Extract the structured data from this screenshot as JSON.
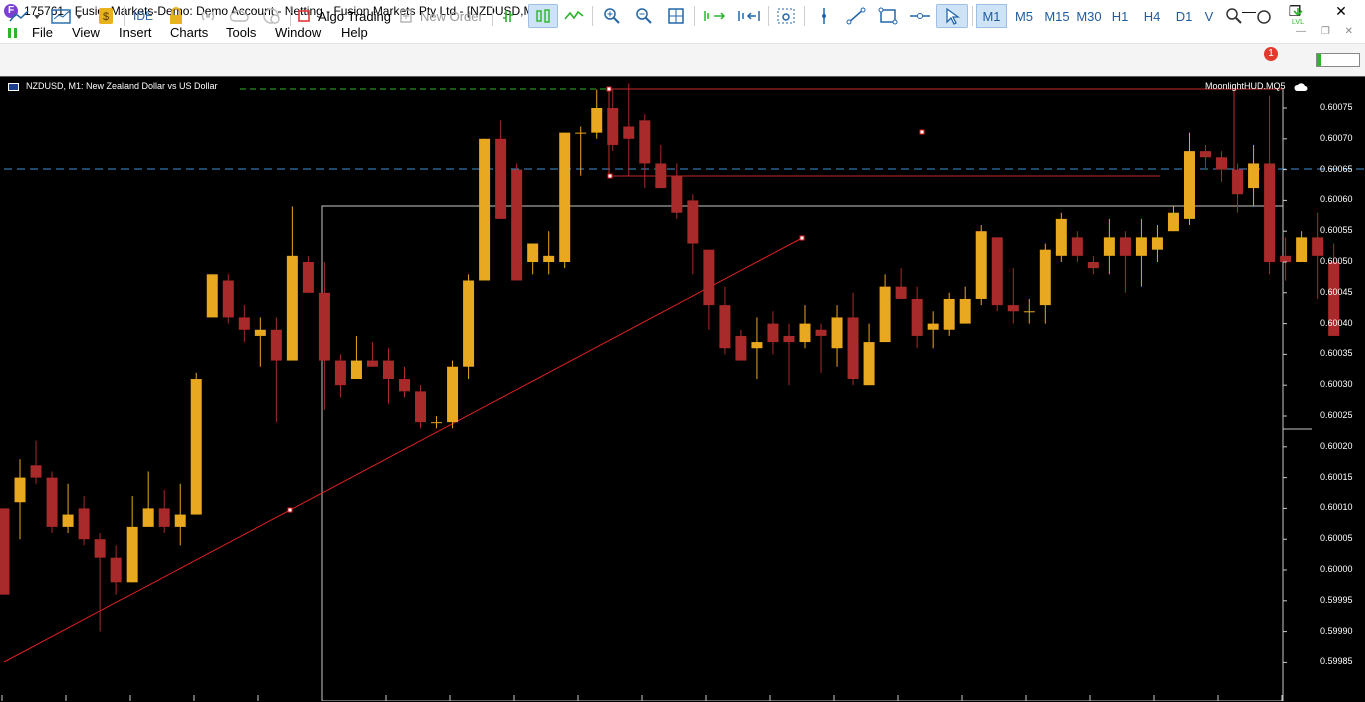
{
  "titlebar": {
    "app_icon": "F",
    "title": "175761 - FusionMarkets-Demo: Demo Account - Netting - Fusion Markets Pty Ltd - [NZDUSD,M1]",
    "minimize": "—",
    "maximize": "❐",
    "close": "✕"
  },
  "menu": {
    "items": [
      "File",
      "View",
      "Insert",
      "Charts",
      "Tools",
      "Window",
      "Help"
    ],
    "right_controls": "— ❐ ✕"
  },
  "toolbar": {
    "ide_label": "IDE",
    "algo_trading_label": "Algo Trading",
    "new_order_label": "New Order",
    "timeframes": [
      "M1",
      "M5",
      "M15",
      "M30",
      "H1",
      "H4",
      "D1",
      "V"
    ],
    "active_timeframe": "M1",
    "notification_count": "1",
    "signal_level": 0.1,
    "accent_color": "#2266aa"
  },
  "chart": {
    "title": "NZDUSD, M1:  New Zealand Dollar vs US Dollar",
    "indicator_name": "MoonlightHUD.MQ5",
    "price_labels": [
      "0.60075",
      "0.60070",
      "0.60065",
      "0.60060",
      "0.60055",
      "0.60050",
      "0.60045",
      "0.60040",
      "0.60035",
      "0.60030",
      "0.60025",
      "0.60020",
      "0.60015",
      "0.60010",
      "0.60005",
      "0.60000",
      "0.59995",
      "0.59990",
      "0.59985"
    ],
    "bull_color": "#e8a820",
    "bear_color": "#a82a2a",
    "background_color": "#000000"
  },
  "chart_data": {
    "type": "candlestick",
    "symbol": "NZDUSD",
    "timeframe": "M1",
    "ylim": [
      0.59982,
      0.60079
    ],
    "grid": false,
    "candles": [
      {
        "o": 0.6001,
        "h": 0.6001,
        "l": 0.59996,
        "c": 0.59996
      },
      {
        "o": 0.60011,
        "h": 0.60018,
        "l": 0.60005,
        "c": 0.60015
      },
      {
        "o": 0.60017,
        "h": 0.60021,
        "l": 0.60014,
        "c": 0.60015
      },
      {
        "o": 0.60015,
        "h": 0.60016,
        "l": 0.60006,
        "c": 0.60007
      },
      {
        "o": 0.60007,
        "h": 0.60014,
        "l": 0.60006,
        "c": 0.60009
      },
      {
        "o": 0.6001,
        "h": 0.60012,
        "l": 0.60004,
        "c": 0.60005
      },
      {
        "o": 0.60005,
        "h": 0.60006,
        "l": 0.5999,
        "c": 0.60002
      },
      {
        "o": 0.60002,
        "h": 0.60004,
        "l": 0.59996,
        "c": 0.59998
      },
      {
        "o": 0.59998,
        "h": 0.60012,
        "l": 0.59998,
        "c": 0.60007
      },
      {
        "o": 0.60007,
        "h": 0.60016,
        "l": 0.60007,
        "c": 0.6001
      },
      {
        "o": 0.6001,
        "h": 0.60013,
        "l": 0.60006,
        "c": 0.60007
      },
      {
        "o": 0.60007,
        "h": 0.60014,
        "l": 0.60004,
        "c": 0.60009
      },
      {
        "o": 0.60009,
        "h": 0.60032,
        "l": 0.60009,
        "c": 0.60031
      },
      {
        "o": 0.60041,
        "h": 0.60048,
        "l": 0.60041,
        "c": 0.60048
      },
      {
        "o": 0.60047,
        "h": 0.60048,
        "l": 0.6004,
        "c": 0.60041
      },
      {
        "o": 0.60041,
        "h": 0.60043,
        "l": 0.60037,
        "c": 0.60039
      },
      {
        "o": 0.60038,
        "h": 0.60041,
        "l": 0.60033,
        "c": 0.60039
      },
      {
        "o": 0.60039,
        "h": 0.60041,
        "l": 0.60024,
        "c": 0.60034
      },
      {
        "o": 0.60034,
        "h": 0.60059,
        "l": 0.60034,
        "c": 0.60051
      },
      {
        "o": 0.6005,
        "h": 0.60051,
        "l": 0.60045,
        "c": 0.60045
      },
      {
        "o": 0.60045,
        "h": 0.6005,
        "l": 0.60026,
        "c": 0.60034
      },
      {
        "o": 0.60034,
        "h": 0.60035,
        "l": 0.60028,
        "c": 0.6003
      },
      {
        "o": 0.60031,
        "h": 0.60038,
        "l": 0.60031,
        "c": 0.60034
      },
      {
        "o": 0.60034,
        "h": 0.60037,
        "l": 0.60033,
        "c": 0.60033
      },
      {
        "o": 0.60034,
        "h": 0.60036,
        "l": 0.60027,
        "c": 0.60031
      },
      {
        "o": 0.60031,
        "h": 0.60033,
        "l": 0.60028,
        "c": 0.60029
      },
      {
        "o": 0.60029,
        "h": 0.6003,
        "l": 0.60023,
        "c": 0.60024
      },
      {
        "o": 0.60024,
        "h": 0.60025,
        "l": 0.60023,
        "c": 0.60024
      },
      {
        "o": 0.60024,
        "h": 0.60034,
        "l": 0.60023,
        "c": 0.60033
      },
      {
        "o": 0.60033,
        "h": 0.60048,
        "l": 0.60031,
        "c": 0.60047
      },
      {
        "o": 0.60047,
        "h": 0.6007,
        "l": 0.60047,
        "c": 0.6007
      },
      {
        "o": 0.6007,
        "h": 0.60073,
        "l": 0.60057,
        "c": 0.60057
      },
      {
        "o": 0.60065,
        "h": 0.60066,
        "l": 0.60047,
        "c": 0.60047
      },
      {
        "o": 0.6005,
        "h": 0.60052,
        "l": 0.60048,
        "c": 0.60053
      },
      {
        "o": 0.6005,
        "h": 0.60055,
        "l": 0.60048,
        "c": 0.60051
      },
      {
        "o": 0.6005,
        "h": 0.60071,
        "l": 0.60049,
        "c": 0.60071
      },
      {
        "o": 0.60071,
        "h": 0.60072,
        "l": 0.60064,
        "c": 0.60071
      },
      {
        "o": 0.60071,
        "h": 0.60078,
        "l": 0.6007,
        "c": 0.60075
      },
      {
        "o": 0.60075,
        "h": 0.60078,
        "l": 0.60068,
        "c": 0.60069
      },
      {
        "o": 0.60072,
        "h": 0.60079,
        "l": 0.60064,
        "c": 0.6007
      },
      {
        "o": 0.60073,
        "h": 0.60074,
        "l": 0.60062,
        "c": 0.60066
      },
      {
        "o": 0.60066,
        "h": 0.60069,
        "l": 0.60062,
        "c": 0.60062
      },
      {
        "o": 0.60064,
        "h": 0.60066,
        "l": 0.60057,
        "c": 0.60058
      },
      {
        "o": 0.6006,
        "h": 0.60061,
        "l": 0.60048,
        "c": 0.60053
      },
      {
        "o": 0.60052,
        "h": 0.60052,
        "l": 0.60039,
        "c": 0.60043
      },
      {
        "o": 0.60043,
        "h": 0.60046,
        "l": 0.60035,
        "c": 0.60036
      },
      {
        "o": 0.60038,
        "h": 0.60039,
        "l": 0.60034,
        "c": 0.60034
      },
      {
        "o": 0.60036,
        "h": 0.60041,
        "l": 0.60031,
        "c": 0.60037
      },
      {
        "o": 0.6004,
        "h": 0.60042,
        "l": 0.60035,
        "c": 0.60037
      },
      {
        "o": 0.60038,
        "h": 0.6004,
        "l": 0.6003,
        "c": 0.60037
      },
      {
        "o": 0.60037,
        "h": 0.60043,
        "l": 0.60036,
        "c": 0.6004
      },
      {
        "o": 0.60039,
        "h": 0.6004,
        "l": 0.60032,
        "c": 0.60038
      },
      {
        "o": 0.60036,
        "h": 0.60043,
        "l": 0.60033,
        "c": 0.60041
      },
      {
        "o": 0.60041,
        "h": 0.60045,
        "l": 0.6003,
        "c": 0.60031
      },
      {
        "o": 0.6003,
        "h": 0.6004,
        "l": 0.6003,
        "c": 0.60037
      },
      {
        "o": 0.60037,
        "h": 0.60048,
        "l": 0.60037,
        "c": 0.60046
      },
      {
        "o": 0.60046,
        "h": 0.60049,
        "l": 0.60044,
        "c": 0.60044
      },
      {
        "o": 0.60044,
        "h": 0.60046,
        "l": 0.60036,
        "c": 0.60038
      },
      {
        "o": 0.60039,
        "h": 0.60042,
        "l": 0.60036,
        "c": 0.6004
      },
      {
        "o": 0.60039,
        "h": 0.60045,
        "l": 0.60038,
        "c": 0.60044
      },
      {
        "o": 0.6004,
        "h": 0.60046,
        "l": 0.6004,
        "c": 0.60044
      },
      {
        "o": 0.60044,
        "h": 0.60056,
        "l": 0.60043,
        "c": 0.60055
      },
      {
        "o": 0.60054,
        "h": 0.60054,
        "l": 0.60042,
        "c": 0.60043
      },
      {
        "o": 0.60043,
        "h": 0.60049,
        "l": 0.6004,
        "c": 0.60042
      },
      {
        "o": 0.60042,
        "h": 0.60044,
        "l": 0.6004,
        "c": 0.60042
      },
      {
        "o": 0.60043,
        "h": 0.60053,
        "l": 0.6004,
        "c": 0.60052
      },
      {
        "o": 0.60051,
        "h": 0.60058,
        "l": 0.6005,
        "c": 0.60057
      },
      {
        "o": 0.60054,
        "h": 0.60055,
        "l": 0.6005,
        "c": 0.60051
      },
      {
        "o": 0.6005,
        "h": 0.60051,
        "l": 0.60048,
        "c": 0.60049
      },
      {
        "o": 0.60051,
        "h": 0.60057,
        "l": 0.60048,
        "c": 0.60054
      },
      {
        "o": 0.60054,
        "h": 0.60055,
        "l": 0.60045,
        "c": 0.60051
      },
      {
        "o": 0.60051,
        "h": 0.60057,
        "l": 0.60046,
        "c": 0.60054
      },
      {
        "o": 0.60052,
        "h": 0.60056,
        "l": 0.6005,
        "c": 0.60054
      },
      {
        "o": 0.60055,
        "h": 0.60059,
        "l": 0.60055,
        "c": 0.60058
      },
      {
        "o": 0.60057,
        "h": 0.60071,
        "l": 0.60056,
        "c": 0.60068
      },
      {
        "o": 0.60068,
        "h": 0.60069,
        "l": 0.60065,
        "c": 0.60067
      },
      {
        "o": 0.60067,
        "h": 0.60068,
        "l": 0.60063,
        "c": 0.60065
      },
      {
        "o": 0.60065,
        "h": 0.60066,
        "l": 0.60058,
        "c": 0.60061
      },
      {
        "o": 0.60062,
        "h": 0.60069,
        "l": 0.60059,
        "c": 0.60066
      },
      {
        "o": 0.60066,
        "h": 0.60077,
        "l": 0.60048,
        "c": 0.6005
      },
      {
        "o": 0.60051,
        "h": 0.60054,
        "l": 0.60047,
        "c": 0.6005
      },
      {
        "o": 0.6005,
        "h": 0.60055,
        "l": 0.6005,
        "c": 0.60054
      },
      {
        "o": 0.60054,
        "h": 0.60058,
        "l": 0.60044,
        "c": 0.60051
      },
      {
        "o": 0.6005,
        "h": 0.60053,
        "l": 0.60038,
        "c": 0.60038
      }
    ]
  }
}
